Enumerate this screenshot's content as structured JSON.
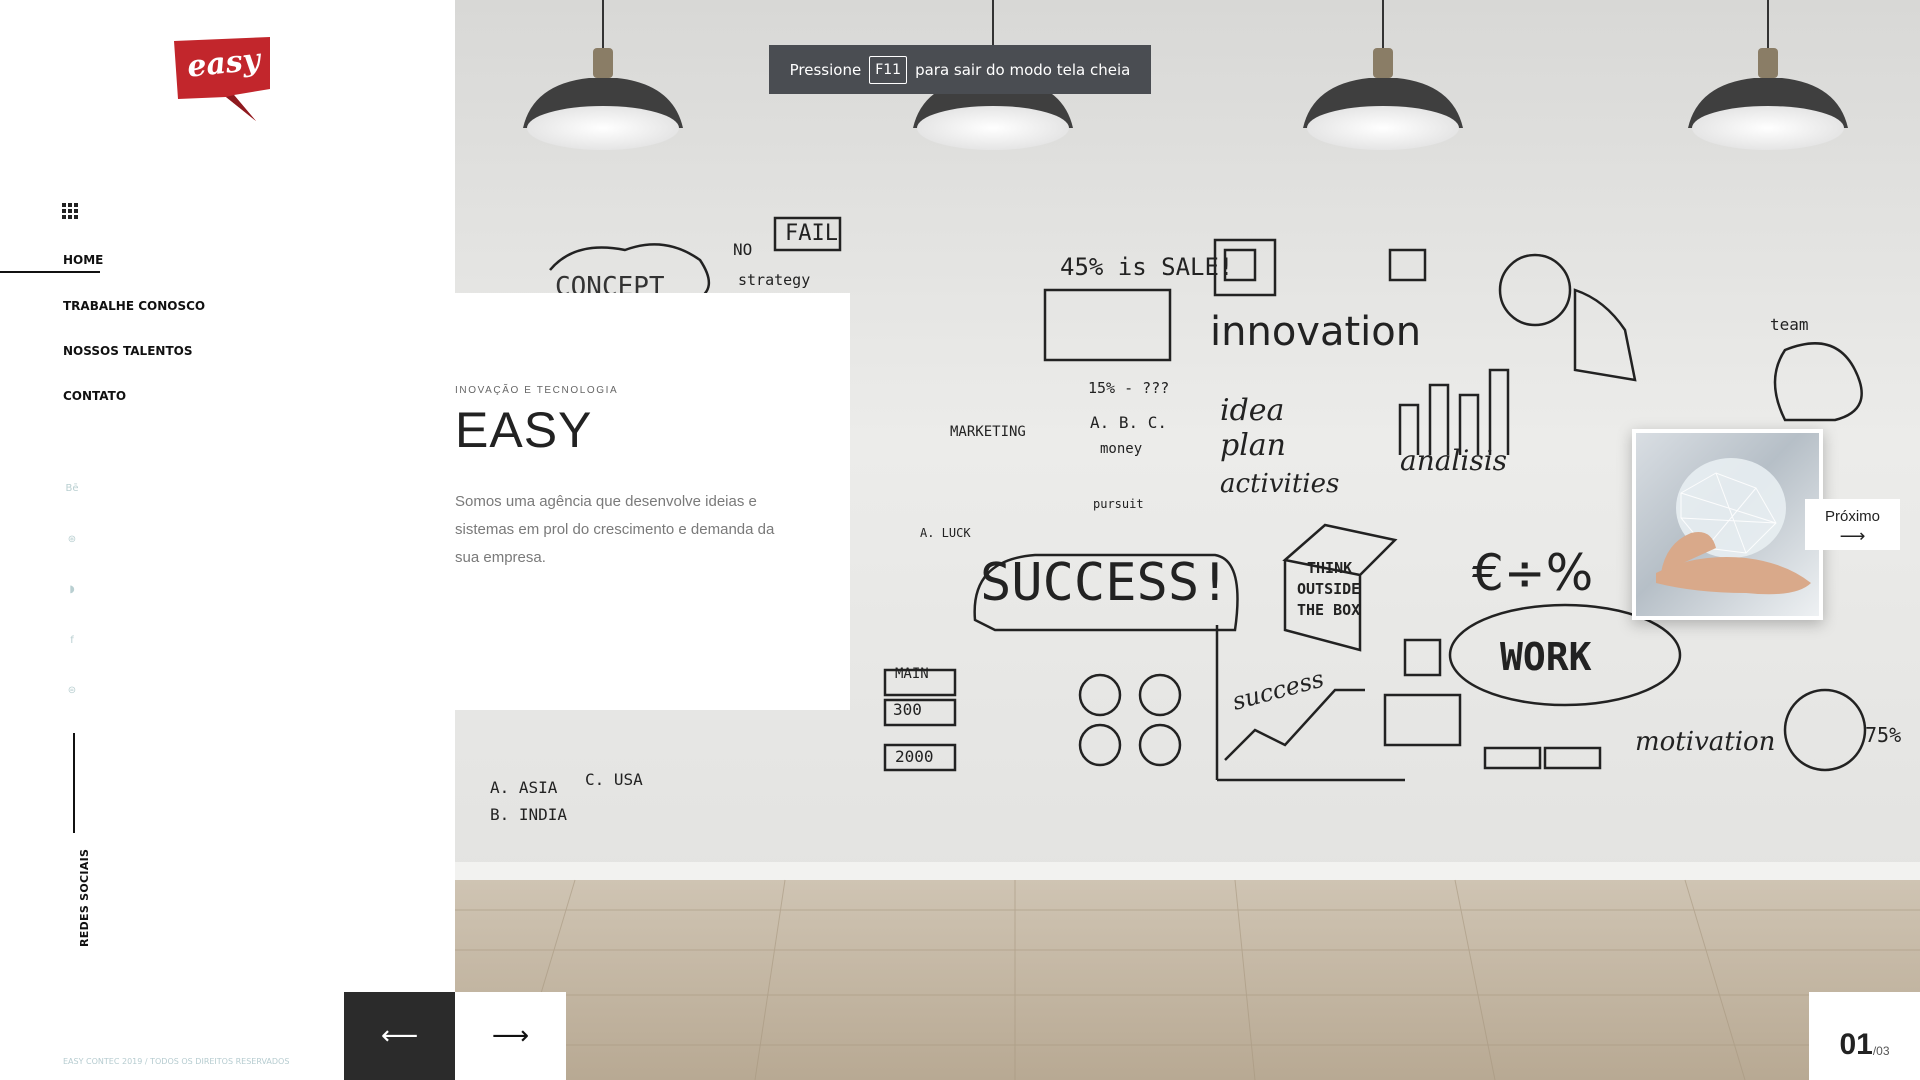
{
  "brand": {
    "logo_text": "easy",
    "logo_color": "#c2262c"
  },
  "nav": {
    "items": [
      {
        "label": "HOME",
        "active": true
      },
      {
        "label": "TRABALHE CONOSCO",
        "active": false
      },
      {
        "label": "NOSSOS TALENTOS",
        "active": false
      },
      {
        "label": "CONTATO",
        "active": false
      }
    ],
    "menu_icon": "grid-icon"
  },
  "social": {
    "icons": [
      "behance-icon",
      "dribbble-icon",
      "rss-icon",
      "facebook-icon",
      "globe-icon"
    ],
    "glyphs": [
      "Bē",
      "⊛",
      "◗",
      "f",
      "⊜"
    ],
    "label": "REDES SOCIAIS"
  },
  "footer": {
    "copyright": "EASY CONTEC 2019 / TODOS OS DIREITOS RESERVADOS"
  },
  "fullscreen_notice": {
    "before": "Pressione",
    "key": "F11",
    "after": "para sair do modo tela cheia"
  },
  "slide": {
    "subtitle": "INOVAÇÃO E TECNOLOGIA",
    "title": "EASY",
    "description": "Somos uma agência que desenvolve ideias e sistemas em prol do crescimento e demanda da sua empresa."
  },
  "next": {
    "label": "Próximo",
    "arrow": "⟶"
  },
  "controls": {
    "prev": "⟵",
    "next": "⟶"
  },
  "counter": {
    "current": "01",
    "total": "/03"
  },
  "wall": {
    "words": [
      "CONCEPT",
      "NO",
      "FAIL",
      "strategy",
      "45% is SALE!",
      "innovation",
      "team",
      "idea",
      "plan",
      "activities",
      "analisis",
      "MARKETING",
      "SUCCESS!",
      "THINK",
      "OUTSIDE",
      "THE BOX",
      "WORK",
      "motivation",
      "MAIN",
      "300",
      "2000",
      "success",
      "A. ASIA",
      "C. USA",
      "B. INDIA",
      "€÷%",
      "75%",
      "15% - ???",
      "A. B. C.",
      "money",
      "pursuit",
      "A. LUCK"
    ]
  },
  "colors": {
    "accent": "#c2262c",
    "dark": "#2b2b2b",
    "social": "#b9cfd1"
  }
}
